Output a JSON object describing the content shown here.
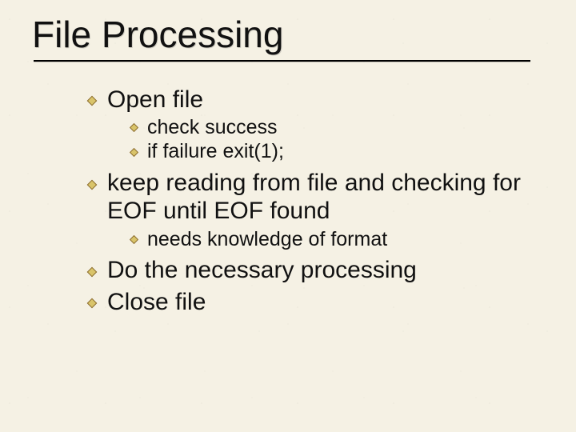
{
  "colors": {
    "background": "#f5f1e4",
    "text": "#111111",
    "bullet_fill": "#d9c46a",
    "bullet_stroke": "#8a6b2c",
    "rule": "#000000"
  },
  "title": "File Processing",
  "bullets": [
    {
      "text": "Open file",
      "sub": [
        "check success",
        "if failure exit(1);"
      ]
    },
    {
      "text": "keep reading from file and checking for EOF until EOF found",
      "sub": [
        "needs knowledge of format"
      ]
    },
    {
      "text": "Do the necessary processing",
      "sub": []
    },
    {
      "text": "Close file",
      "sub": []
    }
  ]
}
